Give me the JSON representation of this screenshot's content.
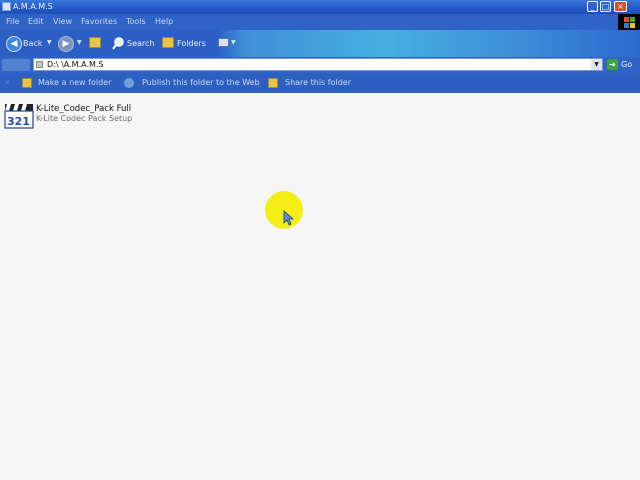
{
  "window": {
    "title": "A.M.A.M.S",
    "controls": {
      "minimize": "_",
      "maximize": "□",
      "close": "×"
    }
  },
  "menu": [
    "File",
    "Edit",
    "View",
    "Favorites",
    "Tools",
    "Help"
  ],
  "toolbar": {
    "back_label": "Back",
    "search_label": "Search",
    "folders_label": "Folders",
    "icons": [
      "back-icon",
      "forward-icon",
      "up-folder-icon",
      "search-icon",
      "folders-icon",
      "views-icon"
    ]
  },
  "address": {
    "path": "D:\\ \\A.M.A.M.S",
    "go_label": "Go"
  },
  "tasks": [
    {
      "label": "Make a new folder",
      "icon": "new-folder-icon"
    },
    {
      "label": "Publish this folder to the Web",
      "icon": "publish-web-icon"
    },
    {
      "label": "Share this folder",
      "icon": "share-folder-icon"
    }
  ],
  "files": [
    {
      "name": "K-Lite_Codec_Pack Full",
      "description": "K-Lite Codec Pack Setup",
      "icon": "klite-installer-icon"
    }
  ],
  "colors": {
    "titlebar": "#2458c6",
    "menubar": "#2f63c6",
    "content_bg": "#f6f6f6",
    "cursor_highlight": "#f5ee16"
  }
}
